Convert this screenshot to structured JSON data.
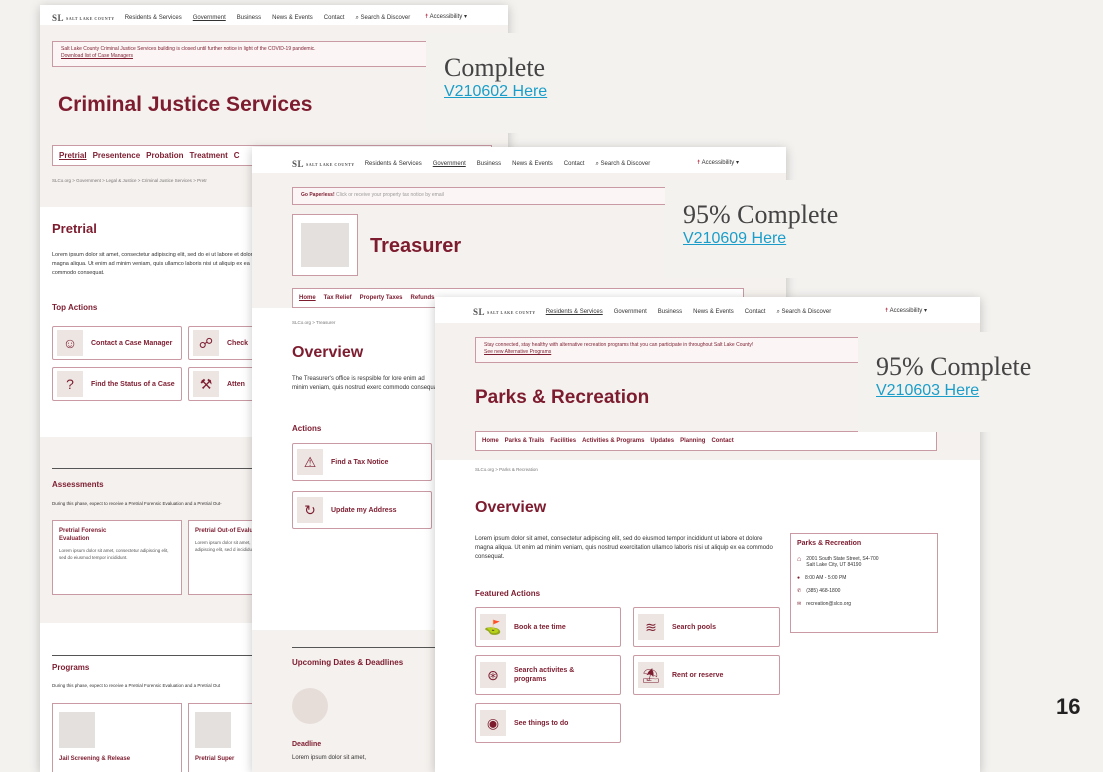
{
  "page_number": "16",
  "nav": {
    "logo": "SL",
    "logo_sub": "SALT LAKE COUNTY",
    "items": [
      "Residents & Services",
      "Government",
      "Business",
      "News & Events",
      "Contact",
      "Search & Discover"
    ],
    "accessibility": "Accessibility"
  },
  "cjs": {
    "alert": "Salt Lake County Criminal Justice Services building is closed until further notice in light of the COVID-19 pandemic.",
    "alert_link": "Download list of Case Managers",
    "title": "Criminal Justice Services",
    "tabs": [
      "Pretrial",
      "Presentence",
      "Probation",
      "Treatment",
      "C"
    ],
    "breadcrumb": "SLCo.org  >  Government  >  Legal & Justice  >  Criminal Justice Services  >  Pretr",
    "section_title": "Pretrial",
    "intro": "Lorem ipsum dolor sit amet, consectetur adipiscing elit, sed do ei ut labore et dolore magna aliqua. Ut enim ad minim veniam, quis ullamco laboris nisi ut aliquip ex ea commodo consequat.",
    "top_actions_title": "Top Actions",
    "actions": [
      "Contact a Case Manager",
      "Check",
      "Find the Status of a Case",
      "Atten"
    ],
    "assessments_title": "Assessments",
    "assessments_text": "During this phase, expect to receive a Pretrial Forensic Evaluation and a Pretrial Out-",
    "assess_cards": [
      {
        "title": "Pretrial Forensic Evaluation",
        "text": "Lorem ipsum dolor sit amet, consectetur adipiscing elit, sed do eiusmod tempor incididunt."
      },
      {
        "title": "Pretrial Out-of Evaluation",
        "text": "Lorem ipsum dolor sit amet, adipiscing elit, sed d incididunt."
      }
    ],
    "programs_title": "Programs",
    "programs_text": "During this phase, expect to receive a Pretrial Forensic Evaluation and a Pretrial Out",
    "program_cards": [
      "Jail Screening & Release",
      "Pretrial Super"
    ]
  },
  "treasurer": {
    "alert_bold": "Go Paperless!",
    "alert_text": "Click or receive your property tax notice by email",
    "title": "Treasurer",
    "tabs": [
      "Home",
      "Tax Relief",
      "Property Taxes",
      "Refunds"
    ],
    "breadcrumb": "SLCo.org  >  Treasurer",
    "overview": "Overview",
    "intro": "The Treasurer's office is respsible for lore enim ad minim veniam, quis nostrud exerc commodo consequat.",
    "actions_title": "Actions",
    "actions": [
      "Find a Tax Notice",
      "Update my Address"
    ],
    "upcoming": "Upcoming Dates & Deadlines",
    "deadline_title": "Deadline",
    "deadline_text": "Lorem ipsum dolor sit amet,"
  },
  "parks": {
    "alert_line1": "Stay connected, stay healthy with alternative recreation programs that you can participate in throughout Salt Lake County!",
    "alert_link": "See new Alternative Programs",
    "title": "Parks & Recreation",
    "tabs": [
      "Home",
      "Parks & Trails",
      "Facilities",
      "Activities & Programs",
      "Updates",
      "Planning",
      "Contact"
    ],
    "breadcrumb": "SLCo.org  >  Parks & Recreation",
    "overview": "Overview",
    "intro": "Lorem ipsum dolor sit amet, consectetur adipiscing elit, sed do eiusmod tempor incididunt ut labore et dolore magna aliqua. Ut enim ad minim veniam, quis nostrud exercitation ullamco laboris nisi ut aliquip ex ea commodo consequat.",
    "featured_title": "Featured Actions",
    "actions": [
      "Book a tee time",
      "Search pools",
      "Search activites & programs",
      "Rent or reserve",
      "See things to do"
    ],
    "contact": {
      "title": "Parks & Recreation",
      "address1": "2001 South State Street, S4-700",
      "address2": "Salt Lake City, UT 84190",
      "hours": "8:00 AM - 5:00 PM",
      "phone": "(385) 468-1800",
      "email": "recreation@slco.org"
    }
  },
  "notes": [
    {
      "status": "Complete",
      "link": "V210602 Here"
    },
    {
      "status": "95% Complete",
      "link": "V210609 Here"
    },
    {
      "status": "95% Complete",
      "link": "V210603 Here"
    }
  ]
}
